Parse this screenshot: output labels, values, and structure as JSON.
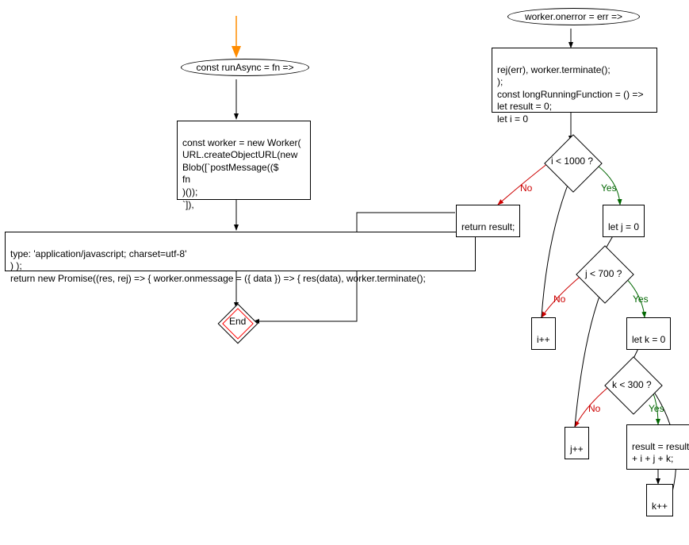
{
  "chart_data": {
    "type": "flowchart",
    "nodes": [
      {
        "id": "start1",
        "shape": "start-arrow",
        "label": ""
      },
      {
        "id": "n1",
        "shape": "ellipse",
        "label": "const runAsync = fn =>"
      },
      {
        "id": "n2",
        "shape": "rect",
        "label": "const worker = new Worker(\nURL.createObjectURL(new\nBlob([`postMessage(($\nfn\n)());\n`]),"
      },
      {
        "id": "n3",
        "shape": "rect",
        "label": "type: 'application/javascript; charset=utf-8'\n) );\nreturn new Promise((res, rej) => { worker.onmessage = ({ data }) => { res(data), worker.terminate();"
      },
      {
        "id": "end",
        "shape": "end",
        "label": "End"
      },
      {
        "id": "n4",
        "shape": "ellipse",
        "label": "worker.onerror = err =>"
      },
      {
        "id": "n5",
        "shape": "rect",
        "label": "rej(err), worker.terminate();\n);\nconst longRunningFunction = () =>\nlet result = 0;\nlet i = 0"
      },
      {
        "id": "d1",
        "shape": "diamond",
        "label": "i < 1000 ?"
      },
      {
        "id": "n6",
        "shape": "rect",
        "label": "return result;"
      },
      {
        "id": "n7",
        "shape": "rect",
        "label": "let j = 0"
      },
      {
        "id": "d2",
        "shape": "diamond",
        "label": "j < 700 ?"
      },
      {
        "id": "n8",
        "shape": "rect",
        "label": "i++"
      },
      {
        "id": "n9",
        "shape": "rect",
        "label": "let k = 0"
      },
      {
        "id": "d3",
        "shape": "diamond",
        "label": "k < 300 ?"
      },
      {
        "id": "n10",
        "shape": "rect",
        "label": "j++"
      },
      {
        "id": "n11",
        "shape": "rect",
        "label": "result = result\n+ i + j + k;"
      },
      {
        "id": "n12",
        "shape": "rect",
        "label": "k++"
      }
    ],
    "edges": [
      {
        "from": "start1",
        "to": "n1"
      },
      {
        "from": "n1",
        "to": "n2"
      },
      {
        "from": "n2",
        "to": "n3"
      },
      {
        "from": "n3",
        "to": "end"
      },
      {
        "from": "n4",
        "to": "n5"
      },
      {
        "from": "n5",
        "to": "d1"
      },
      {
        "from": "d1",
        "to": "n6",
        "label": "No"
      },
      {
        "from": "d1",
        "to": "n7",
        "label": "Yes"
      },
      {
        "from": "n6",
        "to": "end"
      },
      {
        "from": "n7",
        "to": "d2"
      },
      {
        "from": "d2",
        "to": "n8",
        "label": "No"
      },
      {
        "from": "d2",
        "to": "n9",
        "label": "Yes"
      },
      {
        "from": "n8",
        "to": "d1"
      },
      {
        "from": "n9",
        "to": "d3"
      },
      {
        "from": "d3",
        "to": "n10",
        "label": "No"
      },
      {
        "from": "d3",
        "to": "n11",
        "label": "Yes"
      },
      {
        "from": "n10",
        "to": "d2"
      },
      {
        "from": "n11",
        "to": "n12"
      },
      {
        "from": "n12",
        "to": "d3"
      }
    ]
  },
  "labels": {
    "n1": "const runAsync = fn =>",
    "n2": "const worker = new Worker(\nURL.createObjectURL(new\nBlob([`postMessage(($\nfn\n)());\n`]),",
    "n3": "type: 'application/javascript; charset=utf-8'\n) );\nreturn new Promise((res, rej) => { worker.onmessage = ({ data }) => { res(data), worker.terminate();",
    "n4": "worker.onerror = err =>",
    "n5": "rej(err), worker.terminate();\n);\nconst longRunningFunction = () =>\nlet result = 0;\nlet i = 0",
    "d1": "i < 1000 ?",
    "n6": "return result;",
    "n7": "let j = 0",
    "d2": "j < 700 ?",
    "n8": "i++",
    "n9": "let k = 0",
    "d3": "k < 300 ?",
    "n10": "j++",
    "n11": "result = result\n+ i + j + k;",
    "n12": "k++",
    "end": "End",
    "yes": "Yes",
    "no": "No"
  }
}
